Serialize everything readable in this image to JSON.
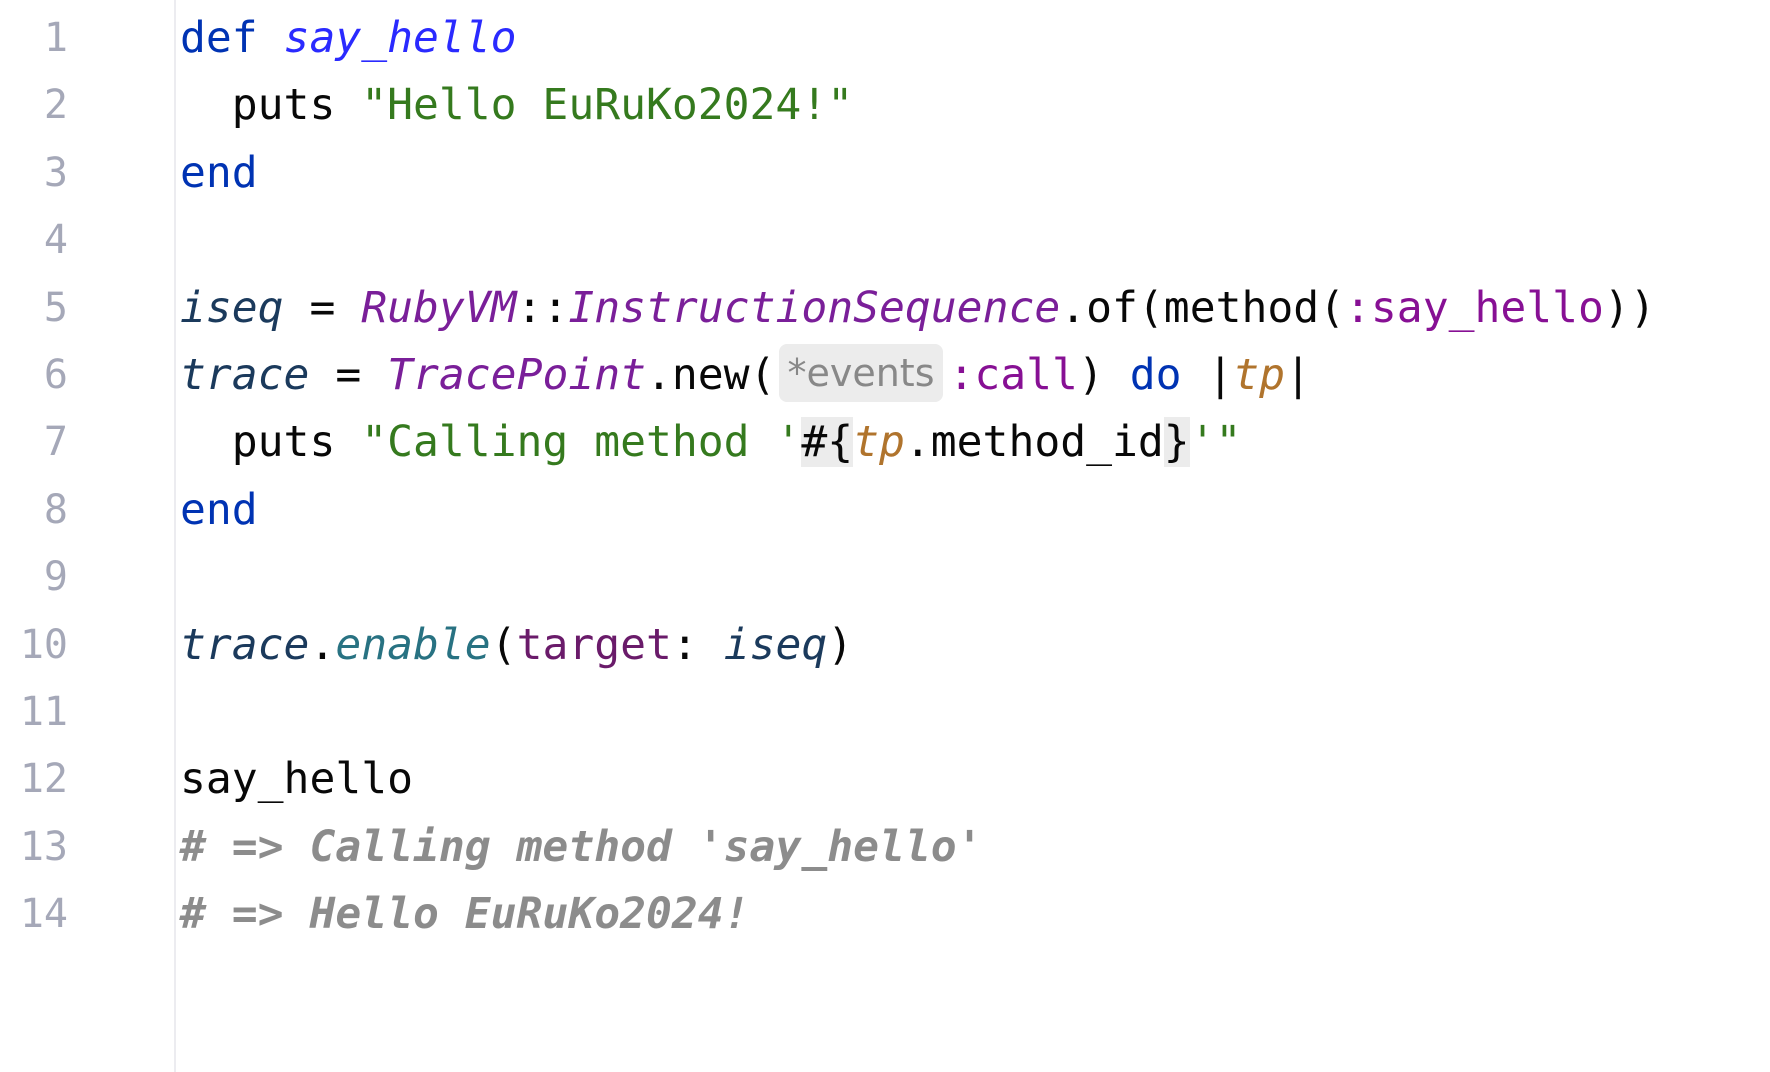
{
  "editor": {
    "language": "ruby",
    "line_numbers": [
      "1",
      "2",
      "3",
      "4",
      "5",
      "6",
      "7",
      "8",
      "9",
      "10",
      "11",
      "12",
      "13",
      "14"
    ],
    "lines": [
      [
        {
          "t": "def",
          "c": "kw"
        },
        {
          "t": " "
        },
        {
          "t": "say_hello",
          "c": "fn-def"
        }
      ],
      [
        {
          "t": "  puts "
        },
        {
          "t": "\"Hello EuRuKo2024!\"",
          "c": "str"
        }
      ],
      [
        {
          "t": "end",
          "c": "kw"
        }
      ],
      [],
      [
        {
          "t": "iseq",
          "c": "var"
        },
        {
          "t": " = "
        },
        {
          "t": "RubyVM",
          "c": "const"
        },
        {
          "t": "::"
        },
        {
          "t": "InstructionSequence",
          "c": "const"
        },
        {
          "t": ".of(method("
        },
        {
          "t": ":say_hello",
          "c": "sym"
        },
        {
          "t": "))"
        }
      ],
      [
        {
          "t": "trace",
          "c": "var"
        },
        {
          "t": " = "
        },
        {
          "t": "TracePoint",
          "c": "const"
        },
        {
          "t": ".new("
        },
        {
          "t": "*events",
          "c": "hint"
        },
        {
          "t": ":call",
          "c": "sym"
        },
        {
          "t": ") "
        },
        {
          "t": "do",
          "c": "kw"
        },
        {
          "t": " |"
        },
        {
          "t": "tp",
          "c": "param"
        },
        {
          "t": "|"
        }
      ],
      [
        {
          "t": "  puts "
        },
        {
          "t": "\"Calling method '",
          "c": "str"
        },
        {
          "t": "#{",
          "c": "interp-mark"
        },
        {
          "t": "tp",
          "c": "param"
        },
        {
          "t": ".method_id"
        },
        {
          "t": "}",
          "c": "interp-mark"
        },
        {
          "t": "'\"",
          "c": "str"
        }
      ],
      [
        {
          "t": "end",
          "c": "kw"
        }
      ],
      [],
      [
        {
          "t": "trace",
          "c": "var"
        },
        {
          "t": "."
        },
        {
          "t": "enable",
          "c": "method-call"
        },
        {
          "t": "("
        },
        {
          "t": "target",
          "c": "named-arg"
        },
        {
          "t": ": "
        },
        {
          "t": "iseq",
          "c": "var"
        },
        {
          "t": ")"
        }
      ],
      [],
      [
        {
          "t": "say_hello"
        }
      ],
      [
        {
          "t": "# => Calling method 'say_hello'",
          "c": "comment"
        }
      ],
      [
        {
          "t": "# => Hello EuRuKo2024!",
          "c": "comment"
        }
      ]
    ]
  }
}
